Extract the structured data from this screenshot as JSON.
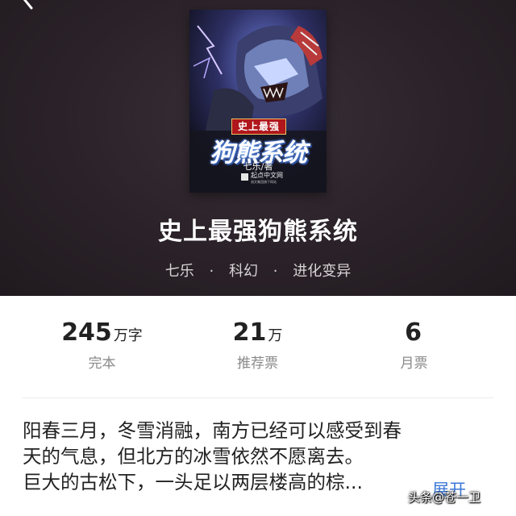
{
  "book": {
    "title": "史上最强狗熊系统",
    "author": "七乐",
    "genre": "科幻",
    "subgenre": "进化变异",
    "separator": "·"
  },
  "cover": {
    "tagline": "史上最强",
    "title": "狗熊系统",
    "author_credit": "七乐/著",
    "publisher": "起点中文网",
    "publisher_sub": "阅文集团旗下网站"
  },
  "stats": [
    {
      "value": "245",
      "unit": "万字",
      "label": "完本"
    },
    {
      "value": "21",
      "unit": "万",
      "label": "推荐票"
    },
    {
      "value": "6",
      "unit": "",
      "label": "月票"
    }
  ],
  "synopsis": {
    "lines": [
      "阳春三月，冬雪消融，南方已经可以感受到春",
      "天的气息，但北方的冰雪依然不愿离去。",
      "巨大的古松下，一头足以两层楼高的棕..."
    ],
    "expand_label": "展开"
  },
  "watermark": "头条@苍一卫",
  "icons": {
    "back": "chevron-left-icon"
  },
  "colors": {
    "header_bg": "#2a2228",
    "link": "#3b78d6",
    "cover_tag": "#b0161b"
  }
}
